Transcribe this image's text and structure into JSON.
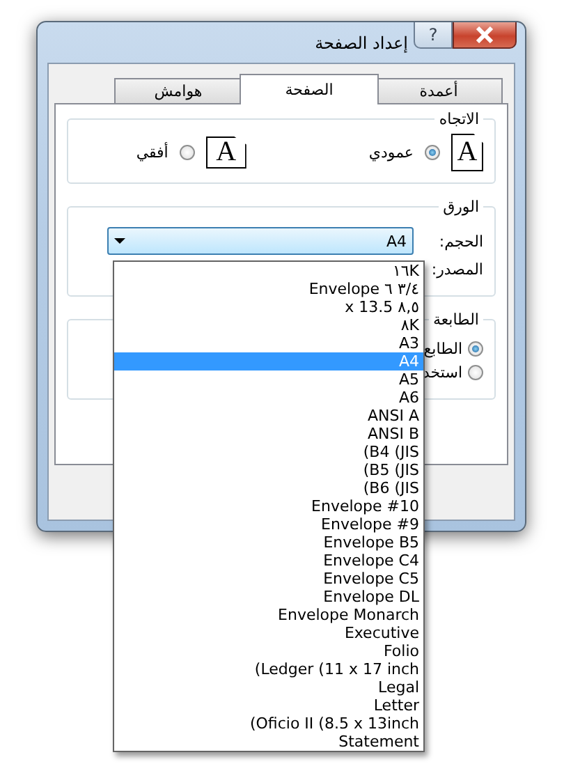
{
  "window": {
    "title": "إعداد الصفحة",
    "help": "?"
  },
  "tabs": [
    {
      "label": "أعمدة",
      "selected": false
    },
    {
      "label": "الصفحة",
      "selected": true
    },
    {
      "label": "هوامش",
      "selected": false
    }
  ],
  "orientation": {
    "title": "الاتجاه",
    "options": [
      {
        "label": "عمودي",
        "selected": true,
        "kind": "portrait",
        "icon_letter": "A"
      },
      {
        "label": "أفقي",
        "selected": false,
        "kind": "landscape",
        "icon_letter": "A"
      }
    ]
  },
  "paper": {
    "title": "الورق",
    "size_label": "الحجم:",
    "size_value": "A4",
    "expanded": true,
    "source_label": "المصدر:"
  },
  "printer": {
    "title": "الطابعة",
    "options": [
      {
        "label": "الطابع",
        "selected": true
      },
      {
        "label": "استخد",
        "selected": false
      }
    ]
  },
  "size_list": [
    {
      "label": "١٦K",
      "selected": false
    },
    {
      "label": "Envelope ٣/٤ ٦",
      "selected": false
    },
    {
      "label": "x 13.5 ٨,٥",
      "selected": false
    },
    {
      "label": "٨K",
      "selected": false
    },
    {
      "label": "A3",
      "selected": false
    },
    {
      "label": "A4",
      "selected": true
    },
    {
      "label": "A5",
      "selected": false
    },
    {
      "label": "A6",
      "selected": false
    },
    {
      "label": "ANSI A",
      "selected": false
    },
    {
      "label": "ANSI B",
      "selected": false
    },
    {
      "label": "(B4 (JIS",
      "selected": false
    },
    {
      "label": "(B5 (JIS",
      "selected": false
    },
    {
      "label": "(B6 (JIS",
      "selected": false
    },
    {
      "label": "Envelope #10",
      "selected": false
    },
    {
      "label": "Envelope #9",
      "selected": false
    },
    {
      "label": "Envelope B5",
      "selected": false
    },
    {
      "label": "Envelope C4",
      "selected": false
    },
    {
      "label": "Envelope C5",
      "selected": false
    },
    {
      "label": "Envelope DL",
      "selected": false
    },
    {
      "label": "Envelope Monarch",
      "selected": false
    },
    {
      "label": "Executive",
      "selected": false
    },
    {
      "label": "Folio",
      "selected": false
    },
    {
      "label": "(Ledger (11 x 17 inch",
      "selected": false
    },
    {
      "label": "Legal",
      "selected": false
    },
    {
      "label": "Letter",
      "selected": false
    },
    {
      "label": "(Oficio II (8.5 x 13inch",
      "selected": false
    },
    {
      "label": "Statement",
      "selected": false
    }
  ]
}
